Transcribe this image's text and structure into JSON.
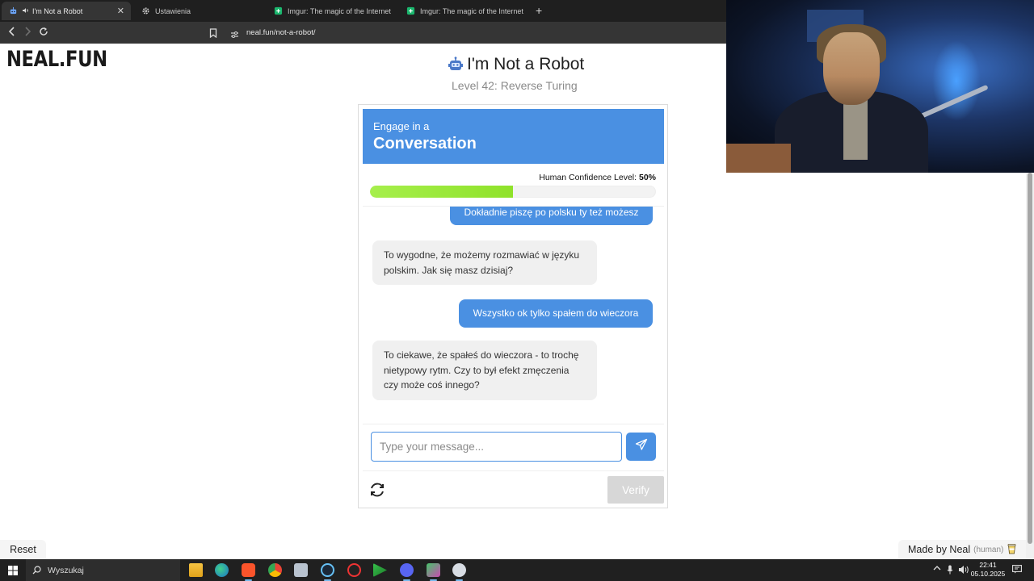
{
  "browser": {
    "tabs": [
      {
        "label": "I'm Not a Robot",
        "active": true
      },
      {
        "label": "Ustawienia",
        "active": false
      },
      {
        "label": "Imgur: The magic of the Internet",
        "active": false
      },
      {
        "label": "Imgur: The magic of the Internet",
        "active": false
      }
    ],
    "new_tab": "+",
    "url": "neal.fun/not-a-robot/"
  },
  "page": {
    "logo": "NEAL.FUN",
    "title": "I'm Not a Robot",
    "subtitle": "Level 42: Reverse Turing",
    "banner_small": "Engage in a",
    "banner_big": "Conversation",
    "confidence_label": "Human Confidence Level: ",
    "confidence_value": "50%",
    "confidence_fraction": 0.5,
    "messages": [
      {
        "role": "user",
        "text": "Dokładnie piszę po polsku ty też możesz"
      },
      {
        "role": "bot",
        "text": "To wygodne, że możemy rozmawiać w języku polskim. Jak się masz dzisiaj?"
      },
      {
        "role": "user",
        "text": "Wszystko ok tylko spałem do wieczora"
      },
      {
        "role": "bot",
        "text": "To ciekawe, że spałeś do wieczora - to trochę nietypowy rytm. Czy to był efekt zmęczenia czy może coś innego?"
      }
    ],
    "input_placeholder": "Type your message...",
    "input_value": "",
    "verify_label": "Verify",
    "reset_label": "Reset",
    "made_by": "Made by Neal",
    "made_by_note": "(human)"
  },
  "taskbar": {
    "search_placeholder": "Wyszukaj",
    "time": "22:41",
    "date": "05.10.2025",
    "apps": [
      "file-explorer-icon",
      "edge-icon",
      "brave-icon",
      "chrome-icon",
      "app-icon",
      "steam-icon",
      "app-icon",
      "app-icon",
      "app-icon",
      "app-icon",
      "app-icon"
    ]
  },
  "colors": {
    "accent": "#4a90e2",
    "progress": "#99e83a",
    "tab_bar": "#1f1f1f",
    "taskbar": "#202020"
  }
}
